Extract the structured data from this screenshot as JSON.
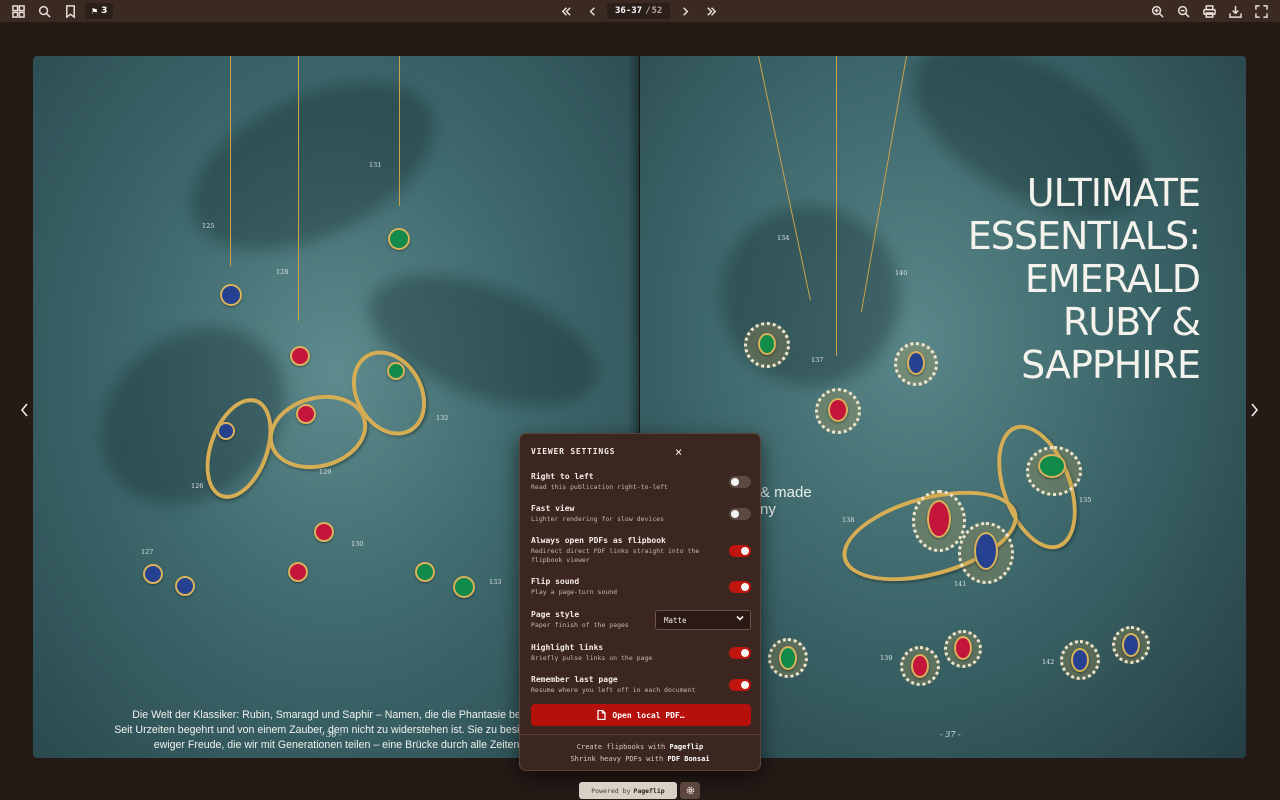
{
  "toolbar": {
    "bookmark_count": "3",
    "current_pages": "36-37",
    "separator": "/",
    "total_pages": "52"
  },
  "spread": {
    "left_page_number": "- 36 -",
    "right_page_number": "- 37 -",
    "left_item_numbers": [
      "125",
      "128",
      "131",
      "126",
      "129",
      "132",
      "127",
      "130",
      "133"
    ],
    "right_item_numbers": [
      "134",
      "137",
      "140",
      "138",
      "141",
      "135",
      "139",
      "142"
    ],
    "body_text": [
      "Die Welt der Klassiker: Rubin, Smaragd und Saphir – Namen, die die Phantasie beflüge",
      "Seit Urzeiten begehrt und von einem Zauber, dem nicht zu widerstehen ist. Sie zu besitzen ist e",
      "ewiger Freude, die wir mit Generationen teilen – eine Brücke durch alle Zeiten."
    ],
    "partial_text": [
      "& made",
      "ny"
    ],
    "headline": [
      "ULTIMATE",
      "ESSENTIALS:",
      "EMERALD",
      "RUBY &",
      "SAPPHIRE"
    ]
  },
  "settings": {
    "title": "VIEWER SETTINGS",
    "close": "×",
    "items": [
      {
        "title": "Right to left",
        "desc": "Read this publication right-to-left",
        "on": false
      },
      {
        "title": "Fast view",
        "desc": "Lighter rendering for slow devices",
        "on": false
      },
      {
        "title": "Always open PDFs as flipbook",
        "desc": "Redirect direct PDF links straight into the flipbook viewer",
        "on": true
      },
      {
        "title": "Flip sound",
        "desc": "Play a page-turn sound",
        "on": true
      },
      {
        "title": "Page style",
        "desc": "Paper finish of the pages"
      },
      {
        "title": "Highlight links",
        "desc": "Briefly pulse links on the page",
        "on": true
      },
      {
        "title": "Remember last page",
        "desc": "Resume where you left off in each document",
        "on": true
      }
    ],
    "page_style_value": "Matte",
    "open_button": "Open local PDF…",
    "footer_1_prefix": "Create flipbooks with",
    "footer_1_link": "Pageflip",
    "footer_2_prefix": "Shrink heavy PDFs with",
    "footer_2_link": "PDF Bonsai"
  },
  "bottom": {
    "powered_prefix": "Powered by",
    "powered_link": "Pageflip"
  },
  "colors": {
    "toolbar_bg": "#3a2a22",
    "panel_bg": "#3b2620",
    "accent_red": "#b5100b",
    "gold": "#d5ad55",
    "sapphire": "#26418f",
    "ruby": "#c4163b",
    "emerald": "#118a4a"
  },
  "icons": [
    "thumbnails-icon",
    "search-icon",
    "bookmark-icon",
    "first-page-icon",
    "prev-page-icon",
    "next-page-icon",
    "last-page-icon",
    "zoom-in-icon",
    "zoom-out-icon",
    "print-icon",
    "download-icon",
    "fullscreen-icon",
    "file-icon",
    "gear-icon"
  ]
}
